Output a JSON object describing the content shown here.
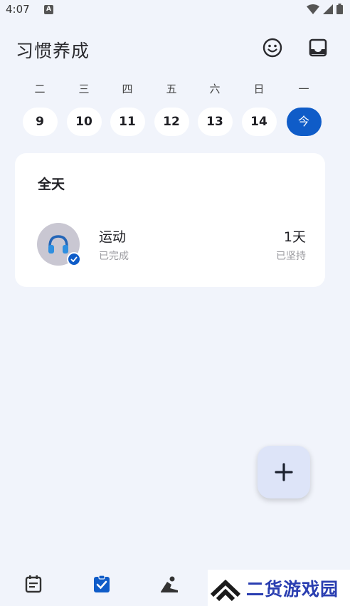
{
  "status_bar": {
    "time": "4:07",
    "notification_badge": "A"
  },
  "app": {
    "title": "习惯养成"
  },
  "week": {
    "days": [
      {
        "label": "二",
        "number": "9",
        "today": false
      },
      {
        "label": "三",
        "number": "10",
        "today": false
      },
      {
        "label": "四",
        "number": "11",
        "today": false
      },
      {
        "label": "五",
        "number": "12",
        "today": false
      },
      {
        "label": "六",
        "number": "13",
        "today": false
      },
      {
        "label": "日",
        "number": "14",
        "today": false
      },
      {
        "label": "一",
        "number": "今",
        "today": true
      }
    ]
  },
  "card": {
    "section_title": "全天",
    "habit": {
      "name": "运动",
      "status": "已完成",
      "streak_value": "1天",
      "streak_label": "已坚持",
      "icon": "headphones-icon"
    }
  },
  "bottom_nav": {
    "items": [
      {
        "icon": "calendar-icon",
        "active": false
      },
      {
        "icon": "clipboard-check-icon",
        "active": true
      },
      {
        "icon": "meditation-icon",
        "active": false
      }
    ]
  },
  "watermark": {
    "text": "二货游戏园"
  },
  "colors": {
    "background": "#f1f4fb",
    "accent": "#0f5cc8",
    "fab_background": "#dde4f8",
    "watermark": "#2a3eb1"
  }
}
